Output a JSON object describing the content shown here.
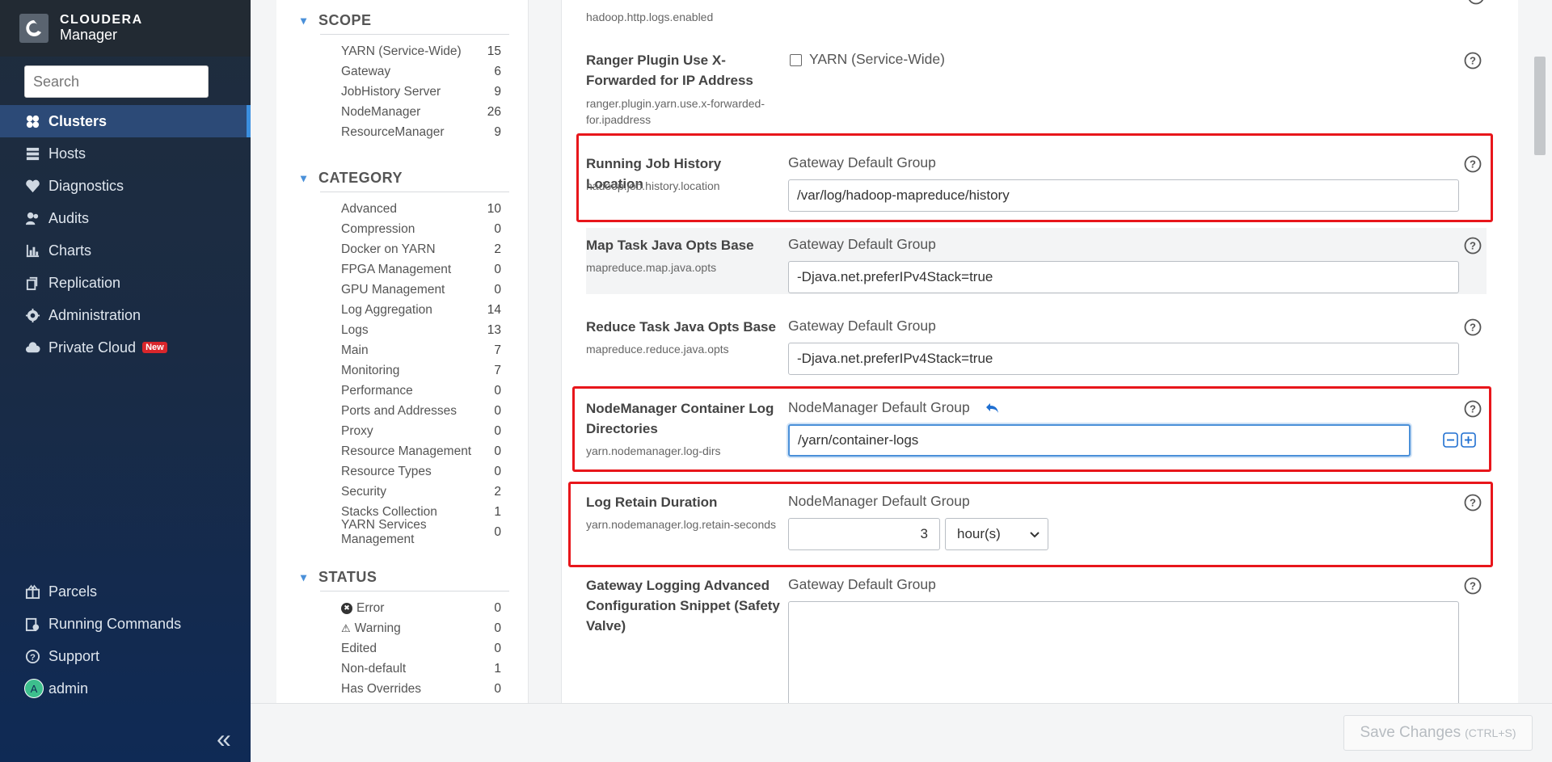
{
  "brand": {
    "line1": "CLOUDERA",
    "line2": "Manager"
  },
  "search": {
    "placeholder": "Search"
  },
  "nav": {
    "items": [
      {
        "label": "Clusters",
        "icon": "clusters-icon",
        "active": true
      },
      {
        "label": "Hosts",
        "icon": "hosts-icon"
      },
      {
        "label": "Diagnostics",
        "icon": "diagnostics-icon"
      },
      {
        "label": "Audits",
        "icon": "audits-icon"
      },
      {
        "label": "Charts",
        "icon": "charts-icon"
      },
      {
        "label": "Replication",
        "icon": "replication-icon"
      },
      {
        "label": "Administration",
        "icon": "gear-icon"
      },
      {
        "label": "Private Cloud",
        "icon": "cloud-icon",
        "badge": "New"
      }
    ],
    "bottom": [
      {
        "label": "Parcels",
        "icon": "parcels-icon"
      },
      {
        "label": "Running Commands",
        "icon": "running-commands-icon"
      },
      {
        "label": "Support",
        "icon": "support-icon"
      },
      {
        "label": "admin",
        "icon": "avatar",
        "avatar_letter": "A"
      }
    ]
  },
  "filters": {
    "scope": {
      "title": "SCOPE",
      "rows": [
        {
          "label": "YARN (Service-Wide)",
          "count": "15"
        },
        {
          "label": "Gateway",
          "count": "6"
        },
        {
          "label": "JobHistory Server",
          "count": "9"
        },
        {
          "label": "NodeManager",
          "count": "26"
        },
        {
          "label": "ResourceManager",
          "count": "9"
        }
      ]
    },
    "category": {
      "title": "CATEGORY",
      "rows": [
        {
          "label": "Advanced",
          "count": "10"
        },
        {
          "label": "Compression",
          "count": "0"
        },
        {
          "label": "Docker on YARN",
          "count": "2"
        },
        {
          "label": "FPGA Management",
          "count": "0"
        },
        {
          "label": "GPU Management",
          "count": "0"
        },
        {
          "label": "Log Aggregation",
          "count": "14"
        },
        {
          "label": "Logs",
          "count": "13"
        },
        {
          "label": "Main",
          "count": "7"
        },
        {
          "label": "Monitoring",
          "count": "7"
        },
        {
          "label": "Performance",
          "count": "0"
        },
        {
          "label": "Ports and Addresses",
          "count": "0"
        },
        {
          "label": "Proxy",
          "count": "0"
        },
        {
          "label": "Resource Management",
          "count": "0"
        },
        {
          "label": "Resource Types",
          "count": "0"
        },
        {
          "label": "Security",
          "count": "2"
        },
        {
          "label": "Stacks Collection",
          "count": "1"
        },
        {
          "label": "YARN Services Management",
          "count": "0"
        }
      ]
    },
    "status": {
      "title": "STATUS",
      "rows": [
        {
          "label": "Error",
          "count": "0",
          "icon": "error-icon"
        },
        {
          "label": "Warning",
          "count": "0",
          "icon": "warning-icon"
        },
        {
          "label": "Edited",
          "count": "0"
        },
        {
          "label": "Non-default",
          "count": "1"
        },
        {
          "label": "Has Overrides",
          "count": "0"
        }
      ]
    }
  },
  "configs": {
    "top_key": "hadoop.http.logs.enabled",
    "ranger": {
      "title": "Ranger Plugin Use X-Forwarded for IP Address",
      "key": "ranger.plugin.yarn.use.x-forwarded-for.ipaddress",
      "scope": "YARN (Service-Wide)"
    },
    "job_history": {
      "title": "Running Job History Location",
      "key": "hadoop.job.history.location",
      "scope": "Gateway Default Group",
      "value": "/var/log/hadoop-mapreduce/history"
    },
    "map_opts": {
      "title": "Map Task Java Opts Base",
      "key": "mapreduce.map.java.opts",
      "scope": "Gateway Default Group",
      "value": "-Djava.net.preferIPv4Stack=true"
    },
    "reduce_opts": {
      "title": "Reduce Task Java Opts Base",
      "key": "mapreduce.reduce.java.opts",
      "scope": "Gateway Default Group",
      "value": "-Djava.net.preferIPv4Stack=true"
    },
    "nm_log_dirs": {
      "title": "NodeManager Container Log Directories",
      "key": "yarn.nodemanager.log-dirs",
      "scope": "NodeManager Default Group",
      "value": "/yarn/container-logs"
    },
    "log_retain": {
      "title": "Log Retain Duration",
      "key": "yarn.nodemanager.log.retain-seconds",
      "scope": "NodeManager Default Group",
      "value": "3",
      "unit": "hour(s)"
    },
    "gateway_snippet": {
      "title": "Gateway Logging Advanced Configuration Snippet (Safety Valve)",
      "scope": "Gateway Default Group",
      "value": ""
    }
  },
  "footer": {
    "save_label": "Save Changes",
    "save_hint": "(CTRL+S)"
  },
  "colors": {
    "highlight": "#e8161b",
    "accent": "#3b8fe0",
    "sidebar": "#1a2b44"
  }
}
